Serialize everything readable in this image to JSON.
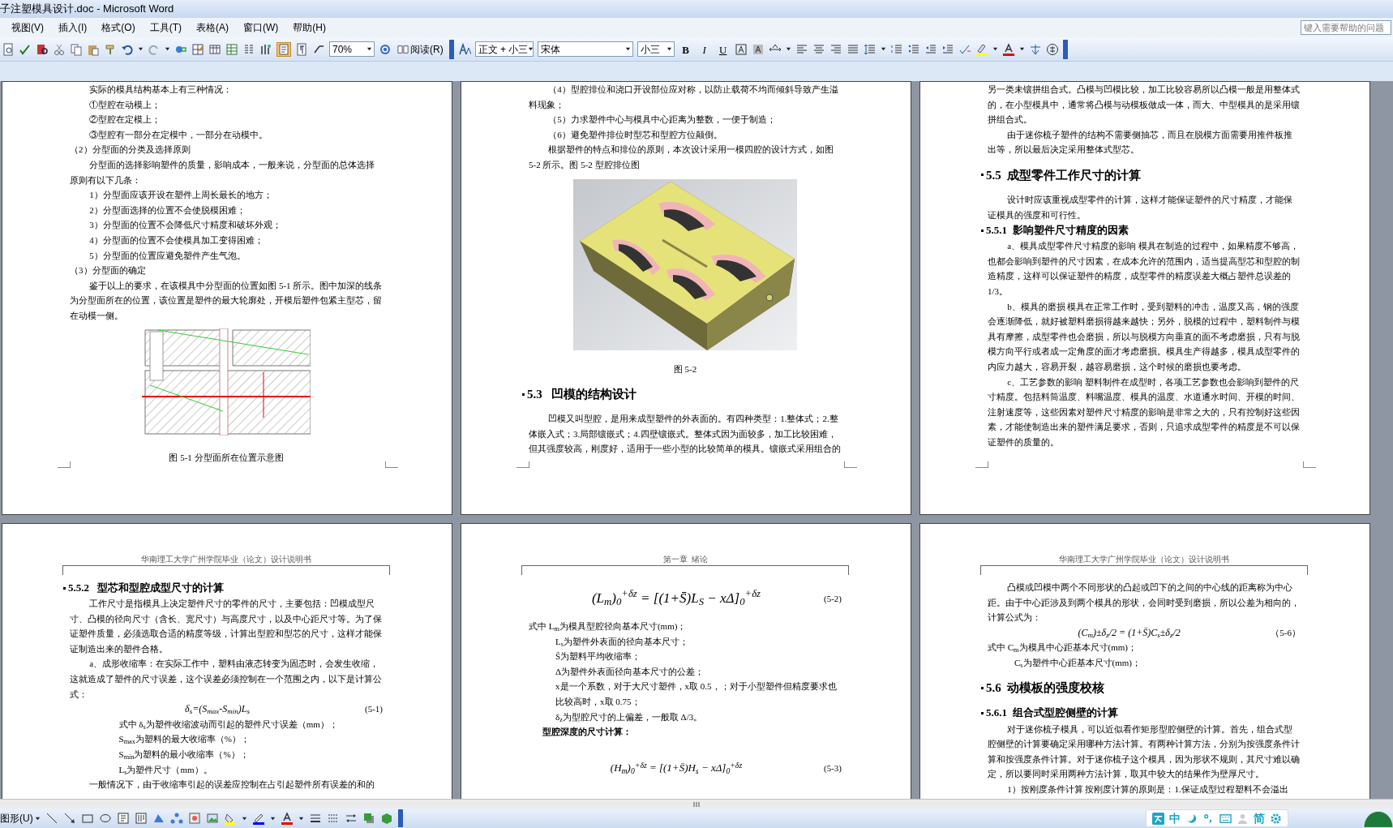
{
  "window": {
    "title": "子注塑模具设计.doc - Microsoft Word"
  },
  "menu_bar": [
    "视图(V)",
    "插入(I)",
    "格式(O)",
    "工具(T)",
    "表格(A)",
    "窗口(W)",
    "帮助(H)"
  ],
  "help_box": {
    "placeholder": "键入需要帮助的问题"
  },
  "toolbar": {
    "zoom": "70%",
    "read_button": "阅读(R)",
    "style": "正文 + 小三",
    "font": "宋体",
    "size": "小三",
    "format_buttons": [
      "B",
      "I",
      "U"
    ]
  },
  "pages": [
    {
      "blocks": [
        {
          "kind": "para",
          "text": "实际的模具结构基本上有三种情况："
        },
        {
          "kind": "para",
          "text": "①型腔在动模上；"
        },
        {
          "kind": "para",
          "text": "②型腔在定模上；"
        },
        {
          "kind": "para",
          "text": "③型腔有一部分在定模中，一部分在动模中。"
        },
        {
          "kind": "line",
          "text": "（2）分型面的分类及选择原则"
        },
        {
          "kind": "para",
          "text": "分型面的选择影响塑件的质量，影响成本，一般来说，分型面的总体选择原则有以下几条："
        },
        {
          "kind": "item",
          "text": "1）分型面应该开设在塑件上周长最长的地方；"
        },
        {
          "kind": "item",
          "text": "2）分型面选择的位置不会使脱模困难；"
        },
        {
          "kind": "item",
          "text": "3）分型面的位置不会降低尺寸精度和破坏外观；"
        },
        {
          "kind": "item",
          "text": "4）分型面的位置不会使模具加工变得困难；"
        },
        {
          "kind": "item",
          "text": "5）分型面的位置应避免塑件产生气泡。"
        },
        {
          "kind": "line",
          "text": "（3）分型面的确定"
        },
        {
          "kind": "para",
          "text": "鉴于以上的要求，在该模具中分型面的位置如图 5-1 所示。图中加深的线条为分型面所在的位置，该位置是塑件的最大轮廓处，开模后塑件包紧主型芯，留在动模一侧。"
        },
        {
          "kind": "picture"
        },
        {
          "kind": "caption",
          "text": "图 5-1  分型面所在位置示意图"
        }
      ]
    },
    {
      "blocks": [
        {
          "kind": "para",
          "text": "（4）型腔排位和浇口开设部位应对称，以防止载荷不均而倾斜导致产生溢料现象；"
        },
        {
          "kind": "para",
          "text": "（5）力求塑件中心与模具中心距离为整数，一便于制造；"
        },
        {
          "kind": "para",
          "text": "（6）避免塑件排位时型芯和型腔方位颠倒。"
        },
        {
          "kind": "para",
          "text": "根据塑件的特点和排位的原则，本次设计采用一模四腔的设计方式，如图 5-2 所示。图 5-2  型腔排位图"
        },
        {
          "kind": "picture"
        },
        {
          "kind": "caption",
          "text": "图 5-2"
        },
        {
          "kind": "heading",
          "text": "5.3   凹模的结构设计"
        },
        {
          "kind": "para",
          "text": "凹模又叫型腔，是用来成型塑件的外表面的。有四种类型：1.整体式；2.整体嵌入式；3.局部镶嵌式；4.四壁镶嵌式。整体式因为面较多，加工比较困难，但其强度较高，刚度好，适用于一些小型的比较简单的模具。镶嵌式采用组合的"
        }
      ]
    },
    {
      "blocks": [
        {
          "kind": "line",
          "text": "另一类未镶拼组合式。凸模与凹模比较，加工比较容易所以凸模一般是用整体式的，在小型模具中，通常将凸模与动模板做成一体，而大、中型模具的是采用镶拼组合式。"
        },
        {
          "kind": "para",
          "text": "由于迷你梳子塑件的结构不需要侧抽芯，而且在脱模方面需要用推件板推出等，所以最后决定采用整体式型芯。"
        },
        {
          "kind": "heading",
          "text": "5.5  成型零件工作尺寸的计算"
        },
        {
          "kind": "para",
          "text": "设计时应该重视成型零件的计算，这样才能保证塑件的尺寸精度，才能保证模具的强度和可行性。"
        },
        {
          "kind": "subheading",
          "text": "5.5.1  影响塑件尺寸精度的因素"
        },
        {
          "kind": "para",
          "text": "a、模具成型零件尺寸精度的影响   模具在制造的过程中，如果精度不够高，也都会影响到塑件的尺寸因素，在成本允许的范围内，适当提高型芯和型腔的制造精度，这样可以保证塑件的精度，成型零件的精度误差大概占塑件总误差的1/3。"
        },
        {
          "kind": "para",
          "text": "b、模具的磨损  模具在正常工作时，受到塑料的冲击，温度又高，钢的强度会逐渐降低，就好被塑料磨损得越来越快；另外，脱模的过程中，塑料制件与模具有摩擦，成型零件也会磨损，所以与脱模方向垂直的面不考虑磨损，只有与脱模方向平行或者成一定角度的面才考虑磨损。模具生产得越多，模具成型零件的内应力越大，容易开裂，越容易磨损，这个时候的磨损也要考虑。"
        },
        {
          "kind": "para",
          "text": "c、工艺参数的影响  塑料制件在成型时，各项工艺参数也会影响到塑件的尺寸精度。包括料筒温度、料嘴温度、模具的温度、水道通水时间、开模的时间、注射速度等，这些因素对塑件尺寸精度的影响是非常之大的，只有控制好这些因素，才能使制造出来的塑件满足要求，否则，只追求成型零件的精度是不可以保证塑件的质量的。"
        }
      ]
    },
    {
      "blocks": [
        {
          "kind": "header",
          "text": "华南理工大学广州学院毕业（论文）设计说明书"
        },
        {
          "kind": "subheading",
          "text": "5.5.2   型芯和型腔成型尺寸的计算"
        },
        {
          "kind": "para",
          "text": "工作尺寸是指模具上决定塑件尺寸的零件的尺寸，主要包括：凹模成型尺寸、凸模的径向尺寸（含长、宽尺寸）与高度尺寸，以及中心距尺寸等。为了保证塑件质量，必须选取合适的精度等级，计算出型腔和型芯的尺寸，这样才能保证制造出来的塑件合格。"
        },
        {
          "kind": "para",
          "text": "a、成形收缩率：在实际工作中，塑料由液态转变为固态时，会发生收缩，这就造成了塑件的尺寸误差，这个误差必须控制在一个范围之内，以下是计算公式："
        },
        {
          "kind": "formula",
          "text": "δ$_{s}$=(S$_{max}$-S$_{min}$)L$_{s}$",
          "number": "(5-1)"
        },
        {
          "kind": "deep",
          "text": "式中  δ$_{s}$为塑件收缩波动而引起的塑件尺寸误差（mm）；"
        },
        {
          "kind": "deep",
          "text": "S$_{max}$为塑料的最大收缩率（%）；"
        },
        {
          "kind": "deep",
          "text": "S$_{min}$为塑料的最小收缩率（%）；"
        },
        {
          "kind": "deep",
          "text": "L$_{s}$为塑件尺寸（mm）。"
        },
        {
          "kind": "para",
          "text": "一般情况下，由于收缩率引起的误差应控制在占引起塑件所有误差的和的"
        }
      ]
    },
    {
      "blocks": [
        {
          "kind": "header",
          "text": "第一章  绪论"
        },
        {
          "kind": "display_formula",
          "text": "(L$_{m}$)$_{0}$$^{+δz}$ = [(1+S̄)L$_{S}$ − xΔ]$_{0}$$^{+δz}$",
          "number": "(5-2)"
        },
        {
          "kind": "line",
          "text": "式中   L$_{m}$为模具型腔径向基本尺寸(mm)；"
        },
        {
          "kind": "cont",
          "text": "L$_{s}$为塑件外表面的径向基本尺寸；"
        },
        {
          "kind": "cont",
          "text": "S̄为塑料平均收缩率；"
        },
        {
          "kind": "cont",
          "text": "Δ为塑件外表面径向基本尺寸的公差；"
        },
        {
          "kind": "cont",
          "text": "x是一个系数，对于大尺寸塑件，x取 0.5，；对于小型塑件但精度要求也比较高时，x取 0.75；"
        },
        {
          "kind": "cont",
          "text": "δ$_{z}$为型腔尺寸的上偏差，一般取 Δ/3。"
        },
        {
          "kind": "bold",
          "text": "型腔深度的尺寸计算："
        },
        {
          "kind": "formula",
          "text": "(H$_{m}$)$_{0}$$^{+δz}$ = [(1+S̄)H$_{s}$ − xΔ]$_{0}$$^{+δz}$",
          "number": "(5-3)"
        }
      ]
    },
    {
      "blocks": [
        {
          "kind": "header",
          "text": "华南理工大学广州学院毕业（论文）设计说明书"
        },
        {
          "kind": "para",
          "text": "凸模或凹模中两个不同形状的凸起或凹下的之间的中心线的距离称为中心距。由于中心距涉及到两个模具的形状，会同时受到磨损，所以公差为相向的，计算公式为："
        },
        {
          "kind": "formula",
          "text": "(C$_{m}$)±δ$_{z}$/2 = (1+S̄)C$_{s}$±δ$_{z}$/2",
          "number": "（5-6）"
        },
        {
          "kind": "line",
          "text": "式中   C$_{m}$为模具中心距基本尺寸(mm)；"
        },
        {
          "kind": "cont",
          "text": "C$_{s}$为塑件中心距基本尺寸(mm)；"
        },
        {
          "kind": "heading",
          "text": "5.6  动模板的强度校核"
        },
        {
          "kind": "subheading",
          "text": "5.6.1  组合式型腔侧壁的计算"
        },
        {
          "kind": "para",
          "text": "对于迷你梳子模具，可以近似看作矩形型腔侧壁的计算。首先，组合式型腔侧壁的计算要确定采用哪种方法计算。有两种计算方法，分别为按强度条件计算和按强度条件计算。对于迷你梳子这个模具，因为形状不规则，其尺寸难以确定，所以要同时采用两种方法计算，取其中较大的结果作为壁厚尺寸。"
        },
        {
          "kind": "para",
          "text": "1）按刚度条件计算    按刚度计算的原则是：1.保证成型过程塑料不会溢出"
        }
      ]
    }
  ],
  "drawing_toolbar": {
    "menu": "图形(U)"
  },
  "ime_bar": {
    "items": [
      "中",
      "简"
    ]
  }
}
